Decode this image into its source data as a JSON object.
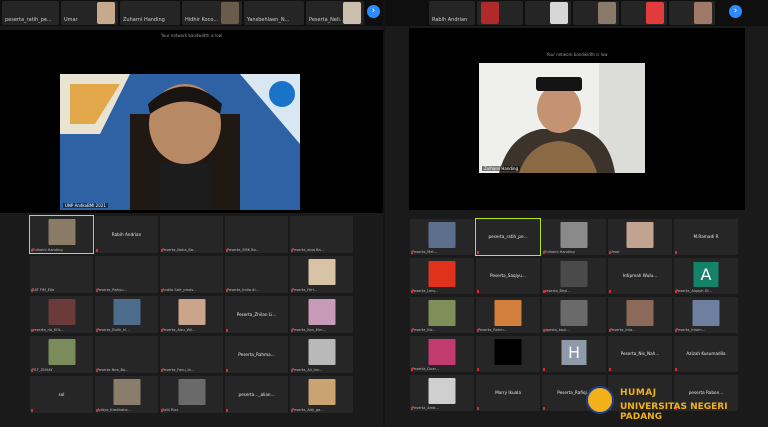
{
  "left_panel": {
    "strip_tiles": [
      {
        "name": "peserta_ratih_pe..."
      },
      {
        "name": "Umar"
      },
      {
        "name": "Zuharni Handing"
      },
      {
        "name": "Hidhir Koco..."
      },
      {
        "name": "Yansbehlaen_N..."
      },
      {
        "name": "Peserta_Neli..."
      }
    ],
    "speaker": {
      "caption": "Your network bandwidth is low",
      "name": "UNP AndkoBMI 2021"
    },
    "gallery": [
      {
        "name": "Zulhaini Handing",
        "active": true,
        "thumb": "#8a7b67"
      },
      {
        "center": "Rabih Andrian"
      },
      {
        "name": "Peserta_Naha_Ba..."
      },
      {
        "name": "Peserta_SMK Bo..."
      },
      {
        "name": "Peserta_aiqa Ba..."
      },
      {
        "name": "BAT FiM_Ella"
      },
      {
        "name": "Peserta_Rahyu..."
      },
      {
        "name": "Andila Safr_pmas..."
      },
      {
        "name": "Peserta_India di..."
      },
      {
        "name": "Peserta_Fitri...",
        "thumb": "#d9c3a6"
      },
      {
        "name": "peserta_ria_KOL...",
        "thumb": "#6b3b3b"
      },
      {
        "name": "Peserta_Bulih_hi...",
        "thumb": "#4d6b8a"
      },
      {
        "name": "Peserta_Aisu_Wil...",
        "thumb": "#caa48b"
      },
      {
        "center": "Peserta_Zhilan Li..."
      },
      {
        "name": "Peserta_Kan_Elm...",
        "thumb": "#c79bb8"
      },
      {
        "name": "PST_ZUHAY",
        "thumb": "#7a8c5a"
      },
      {
        "name": "Peserta Nea_Bo..."
      },
      {
        "name": "Peserta_Fanu_la..."
      },
      {
        "center": "Peserta_Rahma..."
      },
      {
        "name": "Peserta_Ali_lan...",
        "thumb": "#b9b9b9"
      },
      {
        "center": "sol"
      },
      {
        "name": "Aditya_Kreditaha...",
        "thumb": "#8b7d6b"
      },
      {
        "name": "Kalti Rizz",
        "thumb": "#6a6a6a"
      },
      {
        "center": "peserta..._alian..."
      },
      {
        "name": "Peserta_Adji_ga...",
        "thumb": "#c9a472"
      }
    ]
  },
  "right_panel": {
    "strip_tiles": [
      {
        "name": "Rabih Andrian"
      },
      {
        "name": ""
      },
      {
        "name": ""
      },
      {
        "name": ""
      },
      {
        "name": ""
      },
      {
        "name": ""
      }
    ],
    "speaker": {
      "caption": "Your network bandwidth is low",
      "name": "Zulhaini Handing"
    },
    "gallery": [
      {
        "name": "Peserta_Mel...",
        "thumb": "#5c6f8d"
      },
      {
        "center": "peserta_ratih_pe...",
        "active": true
      },
      {
        "name": "Zulhaini Handing",
        "thumb": "#8a8a8a"
      },
      {
        "name": "Umar",
        "thumb": "#c2a38f"
      },
      {
        "center": "M.Ramadi R"
      },
      {
        "name": "Peserta_Leiq...",
        "thumb": "#e0311d"
      },
      {
        "center": "Peserta_Saqiyu..."
      },
      {
        "name": "peserta_Bayi...",
        "thumb": "#4a4a4a"
      },
      {
        "center": "Intipmah Wulu..."
      },
      {
        "name": "Peserta_Aiqayh Di...",
        "letter": "A",
        "letter_bg": "#14836a"
      },
      {
        "name": "Peserta_Kiz...",
        "thumb": "#7f8f5a"
      },
      {
        "name": "Peserta_Rahm...",
        "thumb": "#d27f3b"
      },
      {
        "name": "sjpesta_bayi...",
        "thumb": "#6a6a6a"
      },
      {
        "name": "Peserta_Inta...",
        "thumb": "#8b6a5a"
      },
      {
        "name": "Peserta_Intam...",
        "thumb": "#6f7f9f"
      },
      {
        "name": "Peserta_Duar...",
        "thumb": "#c23b6f"
      },
      {
        "name": "",
        "thumb": "#000000"
      },
      {
        "name": "",
        "letter": "H",
        "letter_bg": "#8e9aa8"
      },
      {
        "center": "Peserta_Nis_Nah..."
      },
      {
        "center": "Azizah Kusumadila"
      },
      {
        "name": "Peserta_Amb...",
        "thumb": "#cfcfcf"
      },
      {
        "center": "Marry Ikuala"
      },
      {
        "center": "Peserta_Rafiqi..."
      },
      {
        "center": ""
      },
      {
        "center": "peserta Rabon..."
      }
    ]
  },
  "watermark": {
    "line1": "HUMAJ",
    "line2": "UNIVERSITAS NEGERI PADANG"
  }
}
